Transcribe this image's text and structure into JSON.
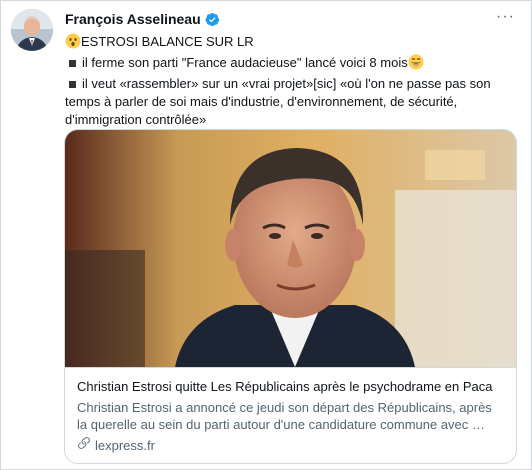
{
  "author": {
    "name": "François Asselineau",
    "avatar_icon": "profile-photo",
    "verified_icon": "verified-badge-icon",
    "verified_color": "#1d9bf0"
  },
  "more_icon": "more-horizontal-icon",
  "tweet": {
    "line1_emoji": "astonished-face-emoji",
    "line1_text": "ESTROSI BALANCE SUR LR",
    "line2_text": "il ferme son parti \"France audacieuse\" lancé voici 8 mois",
    "line2_emoji": "grinning-face-emoji",
    "line3_text": "il veut «rassembler» sur un «vrai projet»[sic] «où l'on ne passe pas son temps à parler de soi mais d'industrie, d'environnement, de sécurité, d'immigration contrôlée»"
  },
  "card": {
    "title": "Christian Estrosi quitte Les Républicains après le psychodrame en Paca",
    "description": "Christian Estrosi a annoncé ce jeudi son départ des Républicains, après la querelle au sein du parti autour d'une candidature commune avec …",
    "domain": "lexpress.fr",
    "link_icon": "link-icon"
  }
}
